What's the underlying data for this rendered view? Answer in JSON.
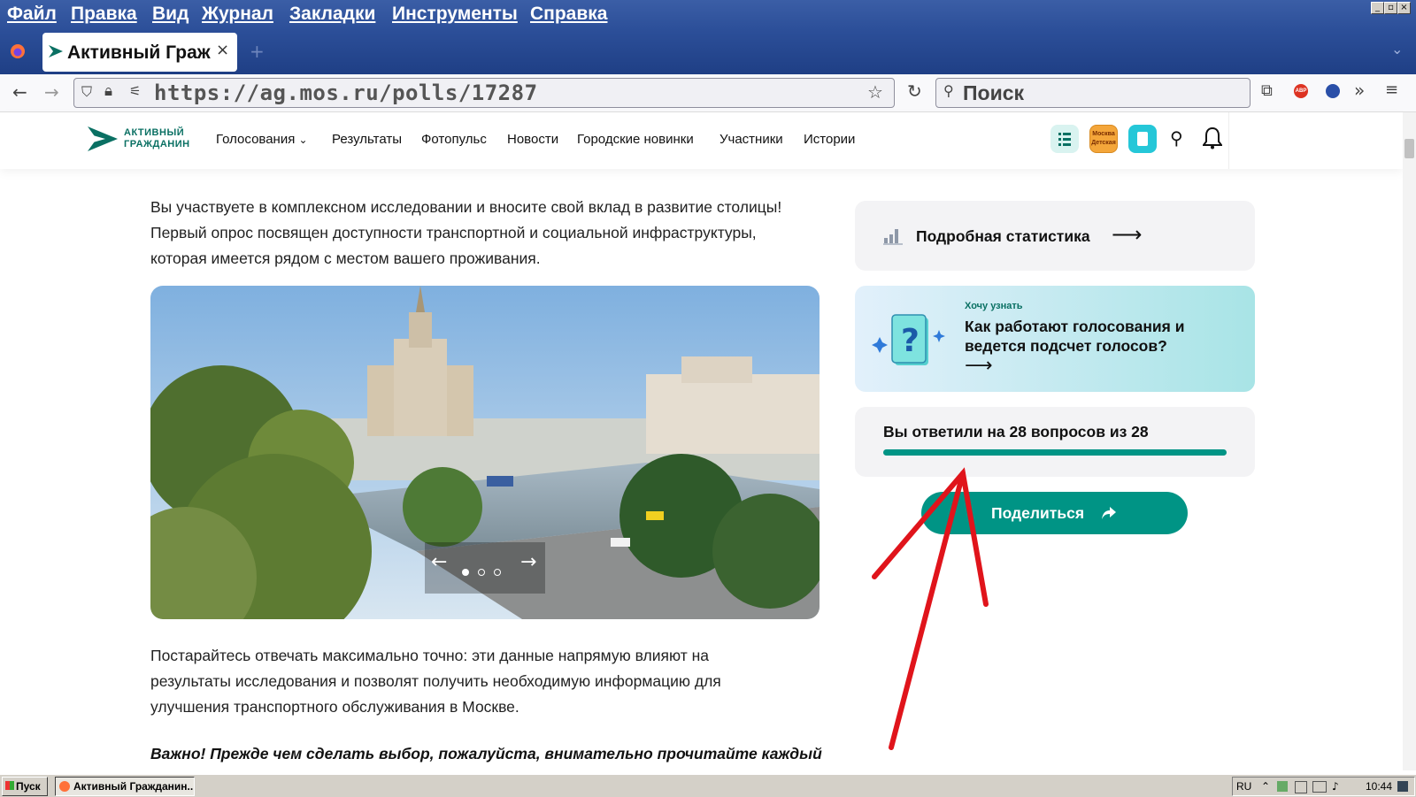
{
  "menubar": {
    "items": [
      "Файл",
      "Правка",
      "Вид",
      "Журнал",
      "Закладки",
      "Инструменты",
      "Справка"
    ]
  },
  "browser": {
    "tab_title": "Активный Граж",
    "url": "https://ag.mos.ru/polls/17287",
    "search_placeholder": "Поиск"
  },
  "site": {
    "logo_line1": "АКТИВНЫЙ",
    "logo_line2": "ГРАЖДАНИН",
    "nav": [
      "Голосования",
      "Результаты",
      "Фотопульс",
      "Новости",
      "Городские новинки",
      "Участники",
      "Истории"
    ],
    "badge_text": "Москва Детская"
  },
  "content": {
    "intro": "Вы участвуете в комплексном исследовании и вносите свой вклад в развитие столицы! Первый опрос посвящен доступности транспортной и социальной инфраструктуры, которая имеется рядом с местом вашего проживания.",
    "carousel": {
      "slides": 3,
      "active": 1
    },
    "body": "Постарайтесь отвечать максимально точно: эти данные напрямую влияют на результаты исследования и позволят получить необходимую информацию для улучшения транспортного обслуживания в Москве.",
    "important": "Важно! Прежде чем сделать выбор, пожалуйста, внимательно прочитайте каждый"
  },
  "sidebar": {
    "stats_label": "Подробная статистика",
    "info_kicker": "Хочу узнать",
    "info_title": "Как работают голосования и ведется подсчет голосов?",
    "progress_text": "Вы ответили на 28 вопросов из 28",
    "progress_fraction": 1.0,
    "share_label": "Поделиться"
  },
  "taskbar": {
    "start_label": "Пуск",
    "task_label": "Активный Гражданин...",
    "lang": "RU",
    "time": "10:44"
  },
  "colors": {
    "accent": "#009485",
    "brand_dark": "#0a7063",
    "annotation_arrow": "#e0141b"
  }
}
